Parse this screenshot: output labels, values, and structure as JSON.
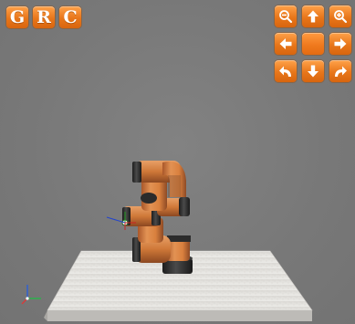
{
  "brand_buttons": [
    {
      "label": "G"
    },
    {
      "label": "R"
    },
    {
      "label": "C"
    }
  ],
  "view_controls": {
    "zoom_out_icon": "zoom-out-icon",
    "zoom_in_icon": "zoom-in-icon",
    "up_icon": "arrow-up-icon",
    "down_icon": "arrow-down-icon",
    "left_icon": "arrow-left-icon",
    "right_icon": "arrow-right-icon",
    "rotate_left_icon": "rotate-left-icon",
    "rotate_right_icon": "rotate-right-icon"
  },
  "colors": {
    "background": "#7a7a7a",
    "button_orange": "#ef7f22",
    "robot_orange": "#d9803e",
    "robot_dark": "#3a3a3a",
    "table_white": "#e8e6e3"
  }
}
